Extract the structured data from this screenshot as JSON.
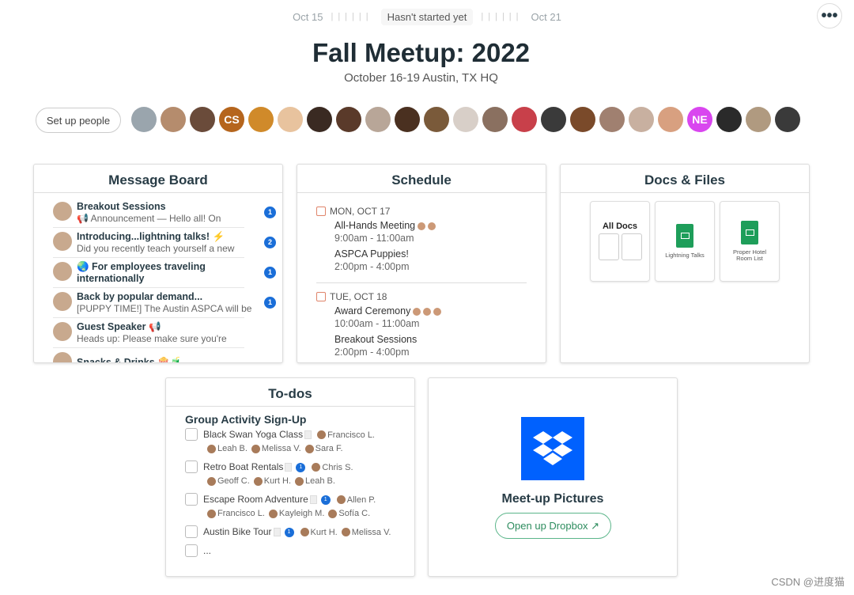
{
  "timeline": {
    "start": "Oct 15",
    "status": "Hasn't started yet",
    "end": "Oct 21"
  },
  "more_icon": "ellipsis-icon",
  "project": {
    "title": "Fall Meetup: 2022",
    "subtitle": "October 16-19 Austin, TX HQ"
  },
  "people": {
    "setup_label": "Set up people",
    "avatars": [
      {
        "c": "#9aa5ad"
      },
      {
        "c": "#b58c6d"
      },
      {
        "c": "#6a4b3a"
      },
      {
        "c": "#b5651d",
        "i": "CS"
      },
      {
        "c": "#d08a2a"
      },
      {
        "c": "#e8c39e"
      },
      {
        "c": "#3a2a22"
      },
      {
        "c": "#5a3a2a"
      },
      {
        "c": "#b8a698"
      },
      {
        "c": "#4a3020"
      },
      {
        "c": "#7a5a3a"
      },
      {
        "c": "#d8cfc8"
      },
      {
        "c": "#8a7060"
      },
      {
        "c": "#c8404a"
      },
      {
        "c": "#3a3a3a"
      },
      {
        "c": "#7a4a2a"
      },
      {
        "c": "#a08070"
      },
      {
        "c": "#c8b0a0"
      },
      {
        "c": "#d8a080"
      },
      {
        "c": "#d946ef",
        "i": "NE"
      },
      {
        "c": "#2a2a2a"
      },
      {
        "c": "#b09a80"
      },
      {
        "c": "#3a3a3a"
      }
    ]
  },
  "message_board": {
    "title": "Message Board",
    "items": [
      {
        "title": "Breakout Sessions",
        "snippet": "📢 Announcement — Hello all! On",
        "count": "1"
      },
      {
        "title": "Introducing...lightning talks! ⚡",
        "snippet": "Did you recently teach yourself a new",
        "count": "2"
      },
      {
        "title": "🌏 For employees traveling internationally",
        "snippet": "",
        "count": "1"
      },
      {
        "title": "Back by popular demand...",
        "snippet": "[PUPPY TIME!] The Austin ASPCA will be",
        "count": "1"
      },
      {
        "title": "Guest Speaker 📢",
        "snippet": "Heads up: Please make sure you're",
        "count": ""
      },
      {
        "title": "Snacks & Drinks 🍿🧃",
        "snippet": "",
        "count": ""
      }
    ]
  },
  "schedule": {
    "title": "Schedule",
    "days": [
      {
        "date": "MON, OCT 17",
        "events": [
          {
            "name": "All-Hands Meeting",
            "time": "9:00am - 11:00am",
            "attendees": 2
          },
          {
            "name": "ASPCA Puppies!",
            "time": "2:00pm - 4:00pm",
            "attendees": 0
          }
        ]
      },
      {
        "date": "TUE, OCT 18",
        "events": [
          {
            "name": "Award Ceremony",
            "time": "10:00am - 11:00am",
            "attendees": 3
          },
          {
            "name": "Breakout Sessions",
            "time": "2:00pm - 4:00pm",
            "attendees": 0
          }
        ]
      }
    ]
  },
  "docs": {
    "title": "Docs & Files",
    "items": [
      {
        "name": "All Docs"
      },
      {
        "name": "Lightning Talks"
      },
      {
        "name": "Proper Hotel Room List"
      }
    ]
  },
  "todos": {
    "title": "To-dos",
    "group": "Group Activity Sign-Up",
    "items": [
      {
        "name": "Black Swan Yoga Class",
        "comments": "",
        "people": [
          "Francisco L.",
          "Leah B.",
          "Melissa V.",
          "Sara F."
        ]
      },
      {
        "name": "Retro Boat Rentals",
        "comments": "1",
        "people": [
          "Chris S.",
          "Geoff C.",
          "Kurt H.",
          "Leah B."
        ]
      },
      {
        "name": "Escape Room Adventure",
        "comments": "1",
        "people": [
          "Allen P.",
          "Francisco L.",
          "Kayleigh M.",
          "Sofía C."
        ]
      },
      {
        "name": "Austin Bike Tour",
        "comments": "1",
        "people": [
          "Kurt H.",
          "Melissa V."
        ]
      },
      {
        "name": "...",
        "comments": "",
        "people": []
      }
    ]
  },
  "dropbox": {
    "title": "Meet-up Pictures",
    "button": "Open up Dropbox ↗"
  },
  "watermark": "CSDN @进度猫"
}
